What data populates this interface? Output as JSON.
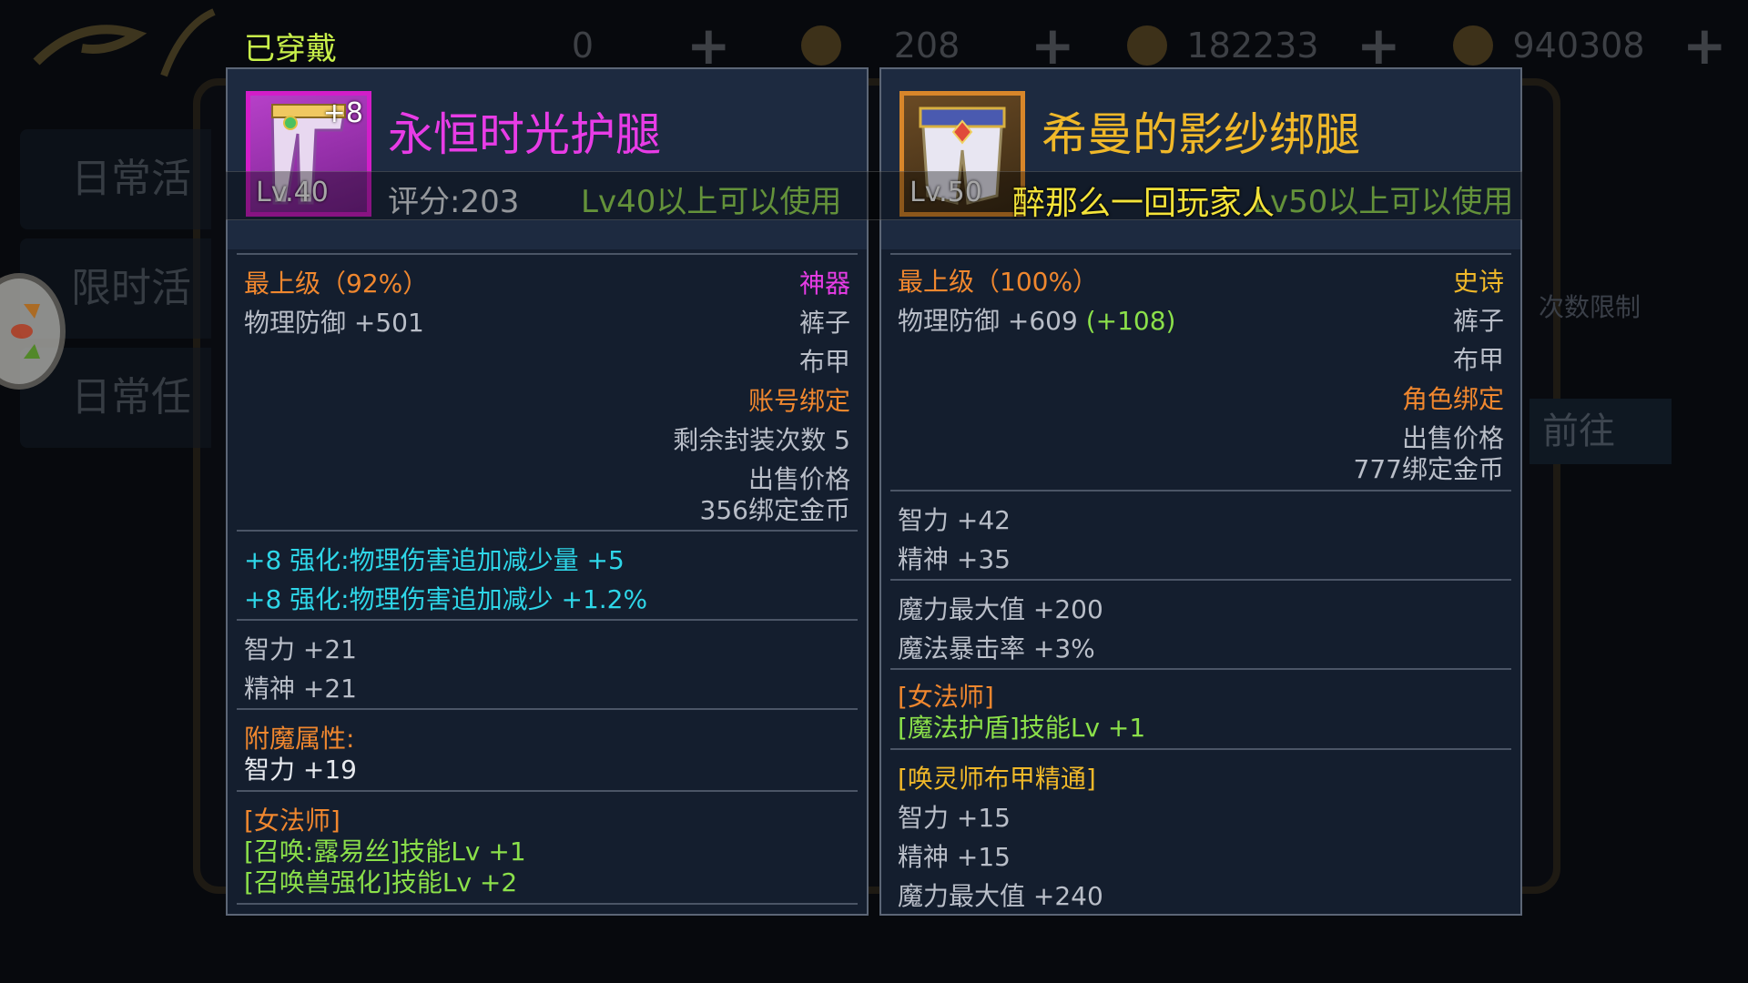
{
  "background": {
    "tabs": [
      "日常活",
      "限时活",
      "日常任"
    ],
    "currencies": [
      {
        "icon": "ticket-icon",
        "value": "0"
      },
      {
        "icon": "scroll-icon",
        "value": "208"
      },
      {
        "icon": "bound-gold-icon",
        "value": "182233"
      },
      {
        "icon": "gold-coin-icon",
        "value": "940308"
      }
    ],
    "right_hint": "次数限制",
    "right_button": "前往"
  },
  "worn_label": "已穿戴",
  "chat_message": "醉那么一回玩家人",
  "left_item": {
    "name": "永恒时光护腿",
    "name_color": "#e03ce0",
    "enhance": "+8",
    "level_badge": "Lv.40",
    "score": "评分:203",
    "requirement": "Lv40以上可以使用",
    "grade": "最上级（92%）",
    "rarity": "神器",
    "phys_def": "物理防御 +501",
    "slot": "裤子",
    "armor_type": "布甲",
    "binding": "账号绑定",
    "seal_count": "剩余封装次数 5",
    "sell_label": "出售价格",
    "sell_price": "356绑定金币",
    "enhance_bonus": [
      "+8 强化:物理伤害追加减少量 +5",
      "+8 强化:物理伤害追加减少 +1.2%"
    ],
    "stats": [
      "智力 +21",
      "精神 +21"
    ],
    "enchant_label": "附魔属性:",
    "enchant_value": "智力 +19",
    "class_label": "[女法师]",
    "class_skills": [
      "[召唤:露易丝]技能Lv +1",
      "[召唤兽强化]技能Lv +2"
    ]
  },
  "right_item": {
    "name": "希曼的影纱绑腿",
    "name_color": "#f0b829",
    "level_badge": "Lv.50",
    "requirement": "Lv50以上可以使用",
    "grade": "最上级（100%）",
    "rarity": "史诗",
    "phys_def": "物理防御 +609",
    "phys_def_diff": "(+108)",
    "slot": "裤子",
    "armor_type": "布甲",
    "binding": "角色绑定",
    "sell_label": "出售价格",
    "sell_price": "777绑定金币",
    "stats": [
      "智力 +42",
      "精神 +35"
    ],
    "magic_stats": [
      "魔力最大值 +200",
      "魔法暴击率 +3%"
    ],
    "class_label": "[女法师]",
    "class_skill": "[魔法护盾]技能Lv +1",
    "set_label": "[唤灵师布甲精通]",
    "set_stats": [
      "智力 +15",
      "精神 +15",
      "魔力最大值 +240"
    ]
  }
}
